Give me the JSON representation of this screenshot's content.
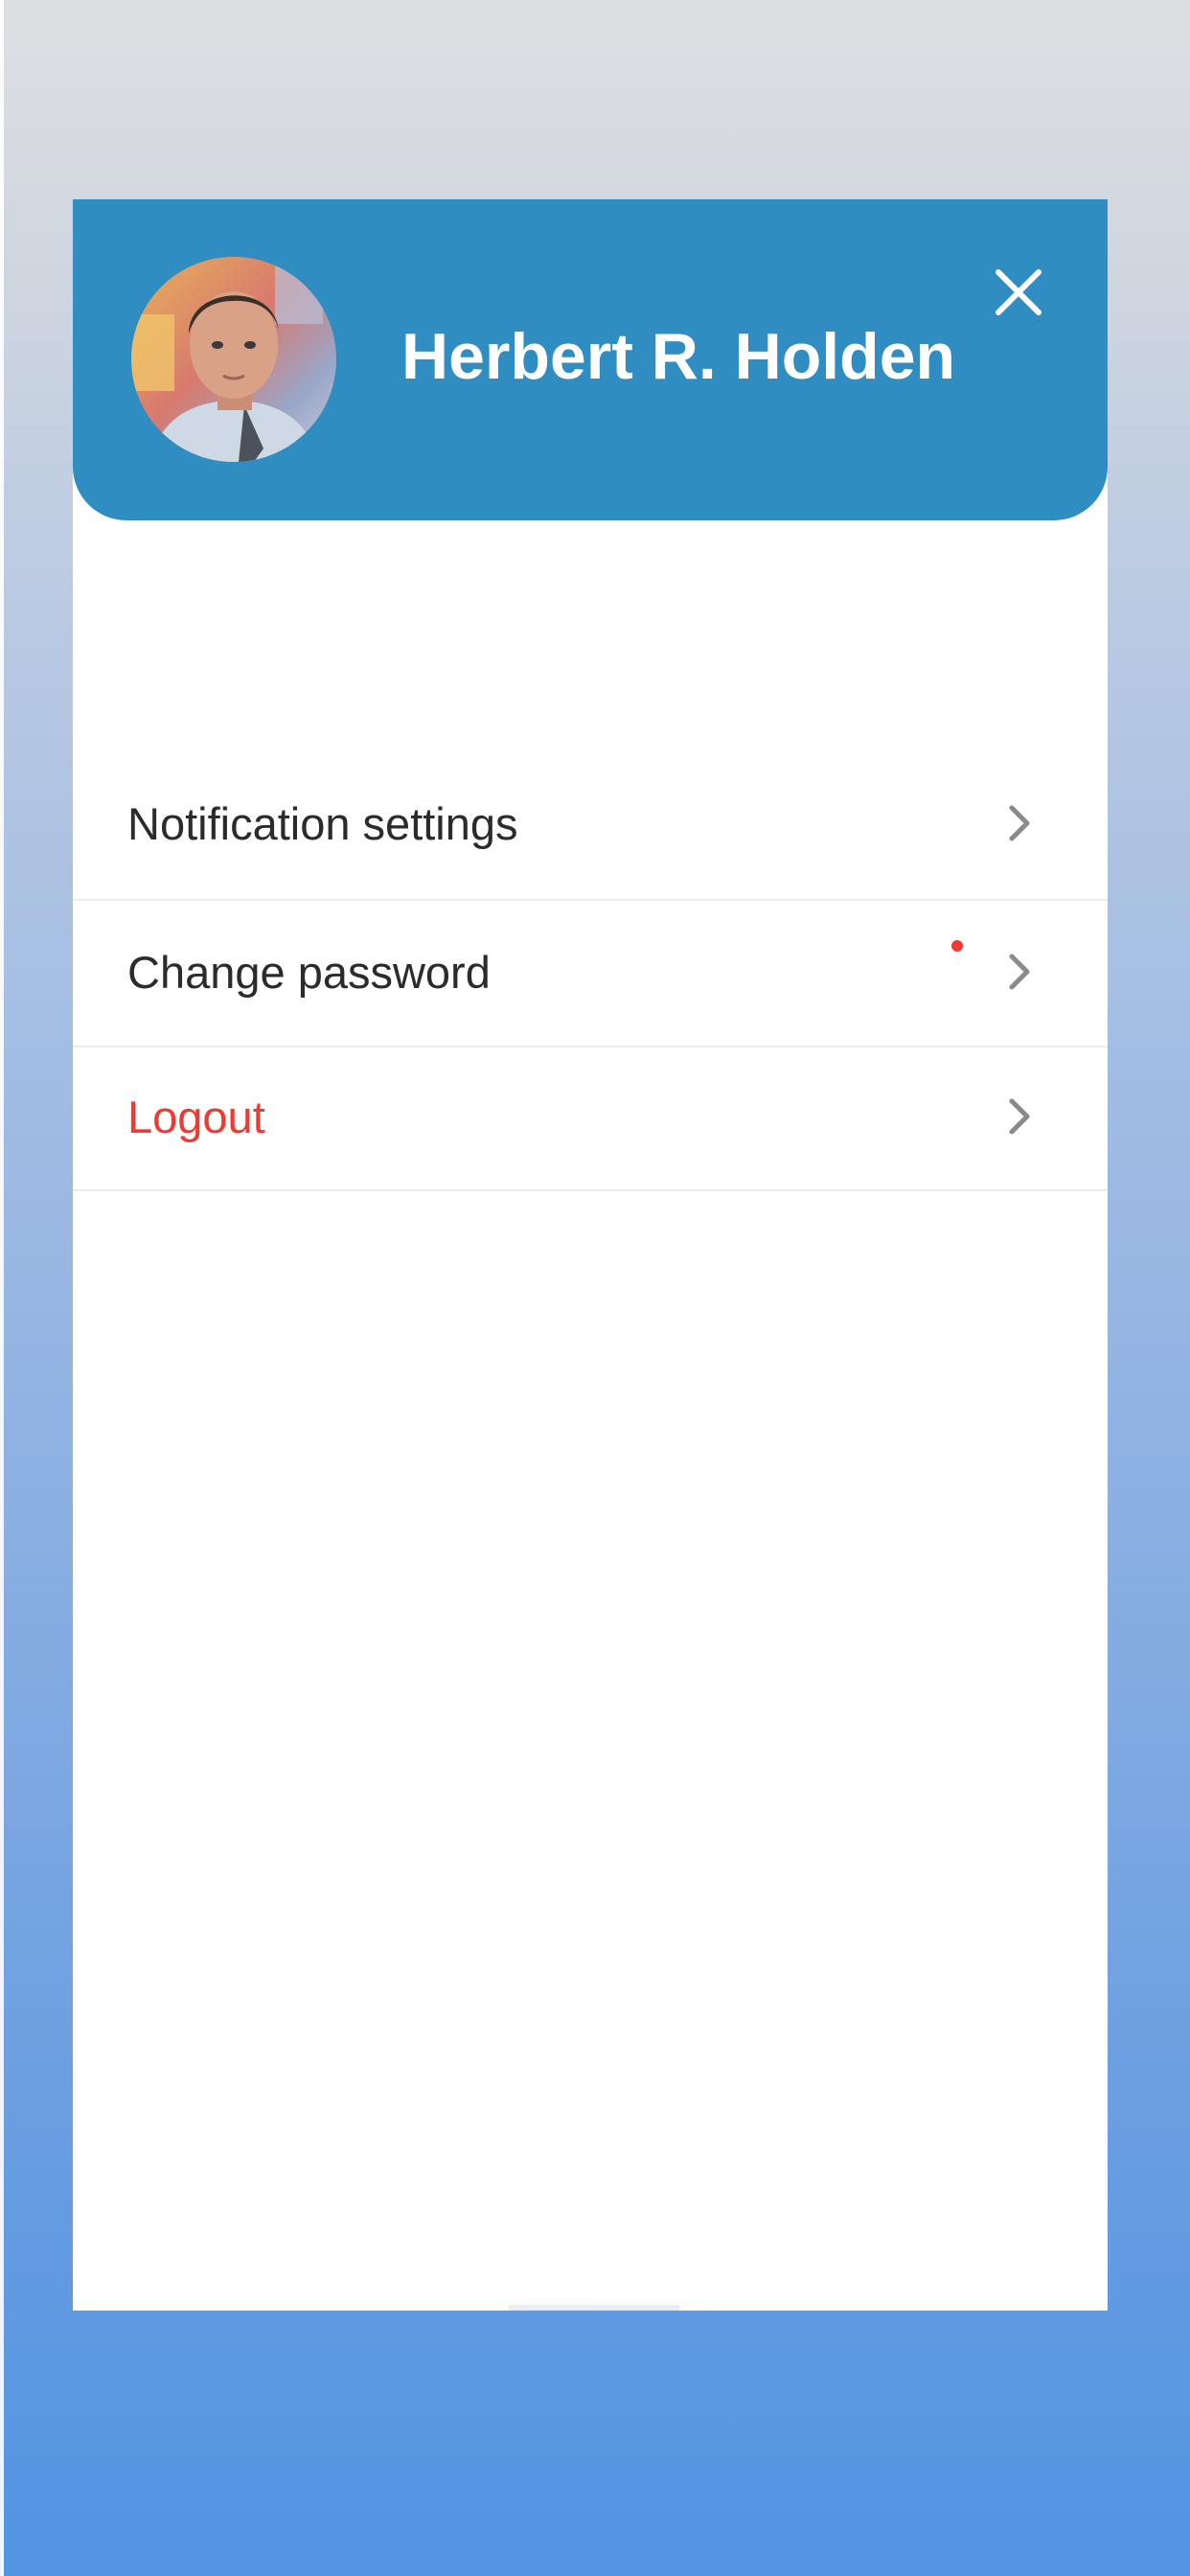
{
  "profile": {
    "name": "Herbert R. Holden",
    "avatar_alt": "profile photo",
    "header_color": "#2f8dc2"
  },
  "header": {
    "close_icon": "close-icon"
  },
  "menu": {
    "items": [
      {
        "label": "Notification settings",
        "has_indicator": true,
        "icon": "chevron-right-icon"
      },
      {
        "label": "Change password",
        "has_indicator": false,
        "icon": "chevron-right-icon"
      },
      {
        "label": "Logout",
        "has_indicator": false,
        "icon": "chevron-right-icon",
        "color": "#ee3a33"
      }
    ]
  },
  "colors": {
    "accent": "#2f8dc2",
    "danger": "#ee3a33",
    "text": "#2b2b2b",
    "chevron": "#8a8a8a"
  }
}
